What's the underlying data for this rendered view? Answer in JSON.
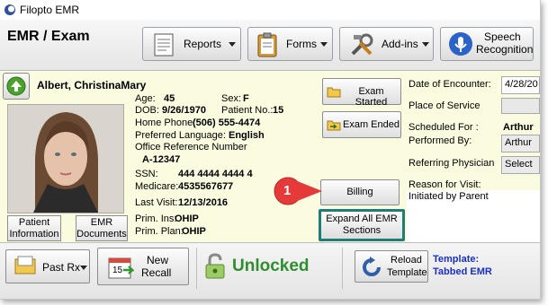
{
  "window": {
    "title": "Filopto EMR"
  },
  "header": {
    "page_title": "EMR / Exam",
    "reports_label": "Reports",
    "forms_label": "Forms",
    "addins_label": "Add-ins",
    "speech_line1": "Speech",
    "speech_line2": "Recognition"
  },
  "patient": {
    "name": "Albert, ChristinaMary",
    "age_label": "Age:",
    "age": "45",
    "sex_label": "Sex:",
    "sex": "F",
    "dob_label": "DOB:",
    "dob": "9/26/1970",
    "patient_no_label": "Patient No.:",
    "patient_no": "15",
    "home_phone_label": "Home Phone:",
    "home_phone": "(506) 555-4474",
    "language_label": "Preferred Language:",
    "language": "English",
    "office_ref_label": "Office Reference Number",
    "office_ref": "A-12347",
    "ssn_label": "SSN:",
    "ssn": "444 4444 4444 4",
    "medicare_label": "Medicare:",
    "medicare": "4535567677",
    "last_visit_label": "Last Visit:",
    "last_visit": "12/13/2016",
    "prim_ins_label": "Prim. Ins:",
    "prim_ins": "OHIP",
    "prim_plan_label": "Prim. Plan:",
    "prim_plan": "OHIP",
    "info_btn_line1": "Patient",
    "info_btn_line2": "Information",
    "docs_btn_line1": "EMR",
    "docs_btn_line2": "Documents"
  },
  "actions": {
    "exam_started": "Exam Started",
    "exam_ended": "Exam Ended",
    "billing": "Billing",
    "expand_line1": "Expand All EMR",
    "expand_line2": "Sections",
    "callout_number": "1"
  },
  "encounter": {
    "date_label": "Date of Encounter:",
    "date_value": "4/28/20",
    "place_label": "Place of Service",
    "scheduled_label": "Scheduled For :",
    "scheduled_value": "Arthur",
    "performed_label": "Performed By:",
    "performed_value": "Arthur",
    "referring_label": "Referring Physician",
    "referring_value": "Select",
    "reason_label": "Reason for Visit:",
    "reason_value": "Initiated by Parent"
  },
  "footer": {
    "past_rx": "Past Rx",
    "new_recall_line1": "New",
    "new_recall_line2": "Recall",
    "calendar_day": "15",
    "unlocked": "Unlocked",
    "reload_line1": "Reload",
    "reload_line2": "Template",
    "template_label": "Template:",
    "template_name": "Tabbed EMR"
  },
  "colors": {
    "unlocked_green": "#2f8f2f",
    "template_blue": "#1a2fc8",
    "callout_red": "#e63a3a",
    "highlight_teal": "#1e7d74",
    "patient_bg": "#fbfbe0"
  }
}
